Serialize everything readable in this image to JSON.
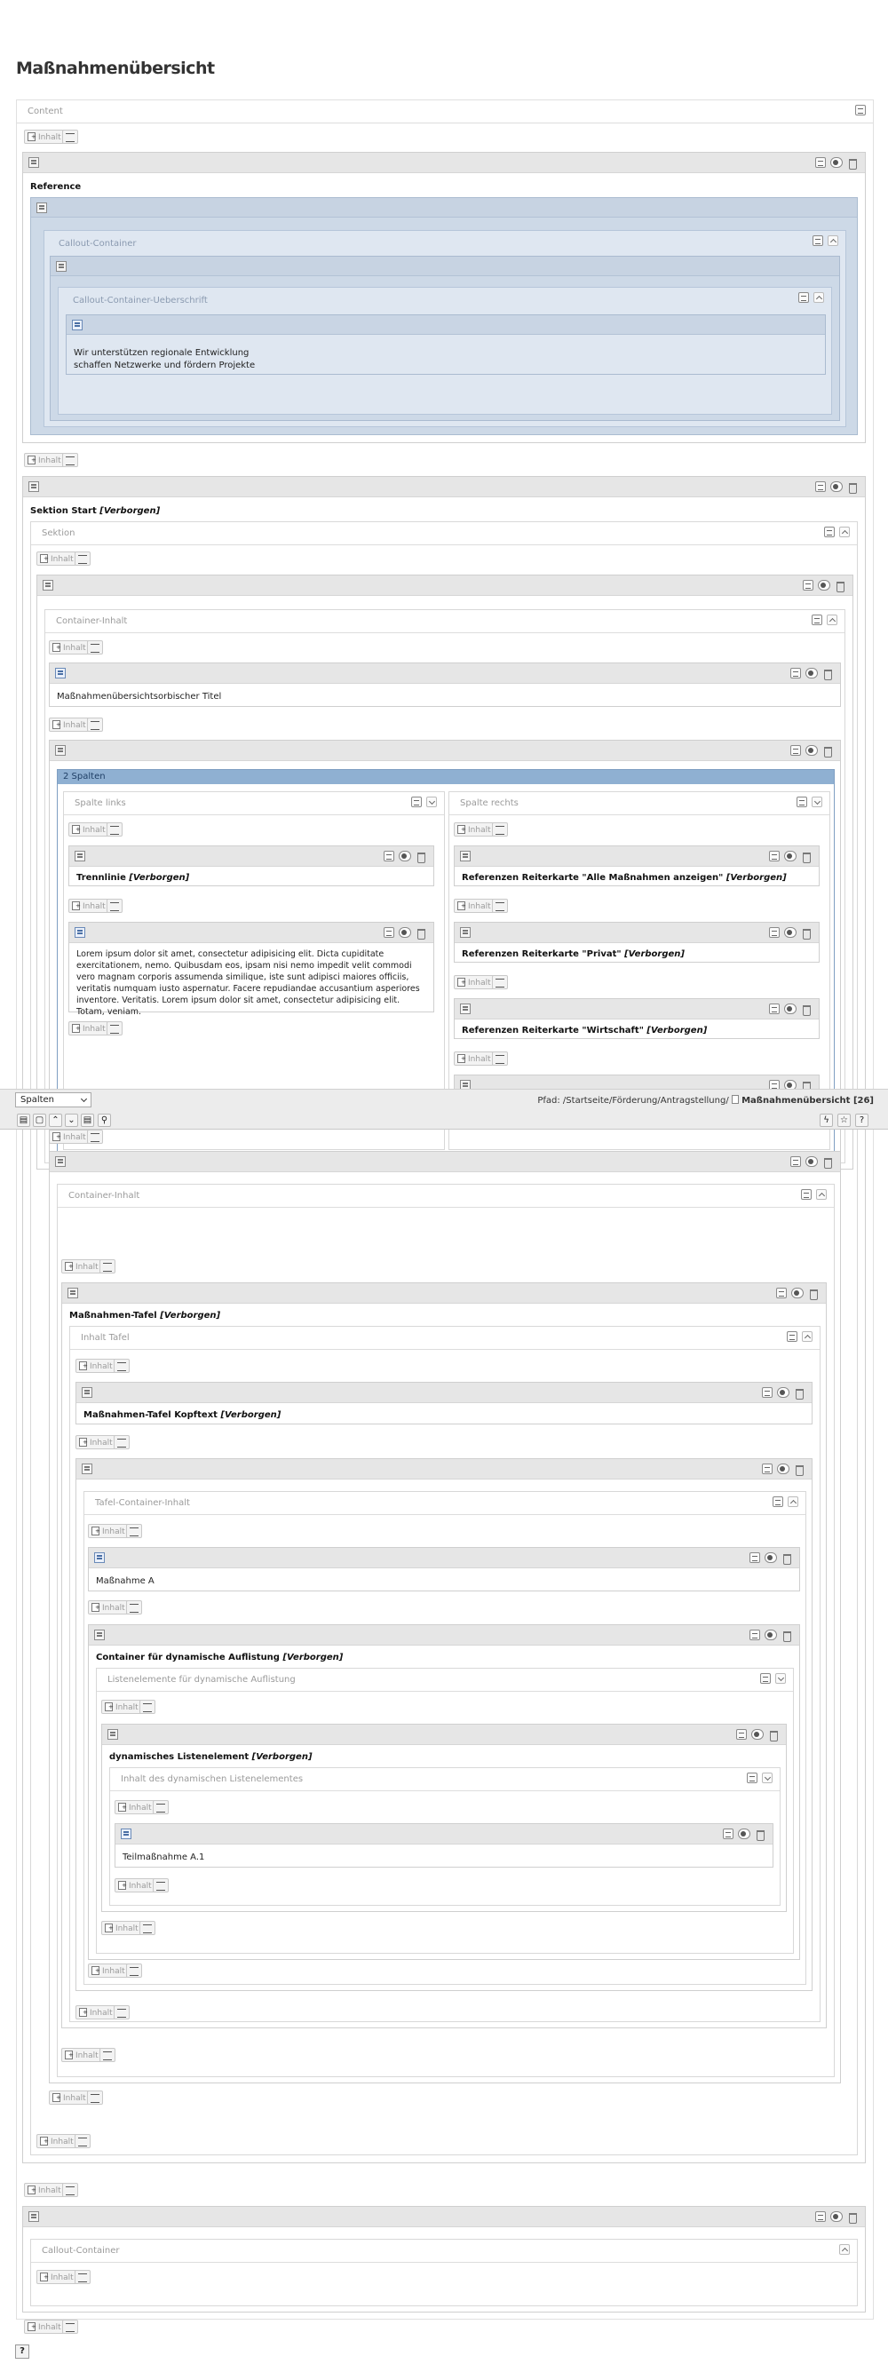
{
  "page_title": "Maßnahmenübersicht",
  "labels": {
    "content": "Content",
    "reference": "Reference",
    "callout_container": "Callout-Container",
    "callout_heading": "Callout-Container-Ueberschrift",
    "callout_text_1": "Wir unterstützen regionale Entwicklung",
    "callout_text_2": "schaffen Netzwerke und fördern Projekte",
    "sektion_start": "Sektion Start",
    "sektion": "Sektion",
    "container_inhalt": "Container-Inhalt",
    "title_text": "Maßnahmenübersichtsorbischer Titel",
    "two_cols": "2 Spalten",
    "col_left": "Spalte links",
    "col_right": "Spalte rechts",
    "trennlinie": "Trennlinie",
    "lorem": "Lorem ipsum dolor sit amet, consectetur adipisicing elit. Dicta cupiditate exercitationem, nemo. Quibusdam eos, ipsam nisi nemo impedit velit commodi vero magnam corporis assumenda similique, iste sunt adipisci maiores officiis, veritatis numquam iusto aspernatur. Facere repudiandae accusantium asperiores inventore. Veritatis. Lorem ipsum dolor sit amet, consectetur adipisicing elit. Totam, veniam.",
    "ref_all": "Referenzen Reiterkarte \"Alle Maßnahmen anzeigen\"",
    "ref_privat": "Referenzen Reiterkarte \"Privat\"",
    "ref_wirtschaft": "Referenzen Reiterkarte \"Wirtschaft\"",
    "tafel": "Maßnahmen-Tafel",
    "inhalt_tafel": "Inhalt Tafel",
    "tafel_kopftext": "Maßnahmen-Tafel Kopftext",
    "tafel_container_inhalt": "Tafel-Container-Inhalt",
    "massnahme_a": "Maßnahme A",
    "container_dyn": "Container für dynamische Auflistung",
    "listenelemente": "Listenelemente für dynamische Auflistung",
    "dyn_listen": "dynamisches Listenelement",
    "inhalt_dyn": "Inhalt des dynamischen Listenelementes",
    "teilmassnahme": "Teilmaßnahme A.1",
    "hidden": "[Verborgen]",
    "inhalt": "Inhalt"
  },
  "docheader": {
    "select_value": "Spalten",
    "path_label": "Pfad: /Startseite/Förderung/Antragstellung/",
    "path_page": "Maßnahmenübersicht [26]"
  },
  "icons": [
    "page-new-icon",
    "paste-icon",
    "edit-icon",
    "toggle-visibility-icon",
    "delete-icon",
    "chevron-up-icon",
    "chevron-down-icon",
    "flash-icon",
    "bookmark-icon",
    "help-icon",
    "search-icon",
    "view-icon"
  ],
  "help_label": "?"
}
